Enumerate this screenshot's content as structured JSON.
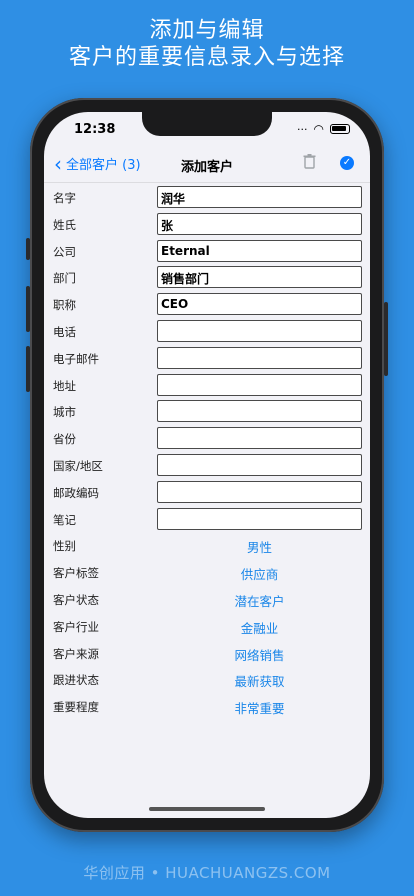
{
  "banner": {
    "line1": "添加与编辑",
    "line2": "客户的重要信息录入与选择"
  },
  "status": {
    "time": "12:38"
  },
  "nav": {
    "back_label": "全部客户 (3)",
    "title": "添加客户"
  },
  "fields": [
    {
      "label": "名字",
      "value": "润华"
    },
    {
      "label": "姓氏",
      "value": "张"
    },
    {
      "label": "公司",
      "value": "Eternal"
    },
    {
      "label": "部门",
      "value": "销售部门"
    },
    {
      "label": "职称",
      "value": "CEO"
    },
    {
      "label": "电话",
      "value": ""
    },
    {
      "label": "电子邮件",
      "value": ""
    },
    {
      "label": "地址",
      "value": ""
    },
    {
      "label": "城市",
      "value": ""
    },
    {
      "label": "省份",
      "value": ""
    },
    {
      "label": "国家/地区",
      "value": ""
    },
    {
      "label": "邮政编码",
      "value": ""
    },
    {
      "label": "笔记",
      "value": ""
    }
  ],
  "pickers": [
    {
      "label": "性别",
      "value": "男性"
    },
    {
      "label": "客户标签",
      "value": "供应商"
    },
    {
      "label": "客户状态",
      "value": "潜在客户"
    },
    {
      "label": "客户行业",
      "value": "金融业"
    },
    {
      "label": "客户来源",
      "value": "网络销售"
    },
    {
      "label": "跟进状态",
      "value": "最新获取"
    },
    {
      "label": "重要程度",
      "value": "非常重要"
    }
  ],
  "footer": {
    "text": "华创应用 • HUACHUANGZS.COM"
  },
  "colors": {
    "background": "#2f8fe4",
    "accent": "#0a7aff",
    "picker_text": "#1a86e8"
  }
}
